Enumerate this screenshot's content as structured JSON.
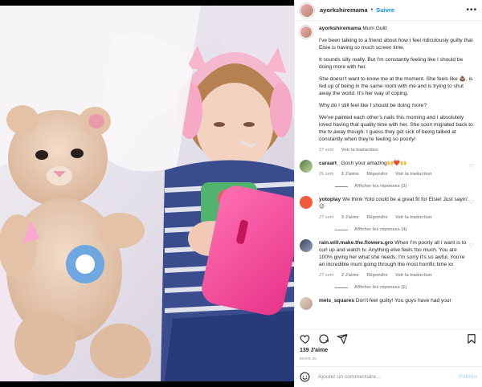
{
  "post": {
    "username": "ayorkshiremama",
    "follow_label": "Suivre",
    "more_label": "•••",
    "caption_title": "Mum Guilt",
    "caption_paragraphs": [
      "I've been talking to a friend about how I feel ridiculously guilty that Elsie is having so much screen time.",
      "It sounds silly really. But I'm constantly feeling like I should be doing more with her.",
      "She doesn't want to know me at the moment. She feels like 💩, is fed up of being in the same room with me and is trying to shut away the world. It's her way of coping.",
      "Why do I still feel like I should be doing more?",
      "We've painted each other's nails this morning and I absolutely loved having that quality time with her. She soon migrated back to the tv away though. I guess they get sick of being talked at constantly when they're feeling so poorly!"
    ],
    "caption_time": "27 sem",
    "translate_label": "Voir la traduction",
    "likes": "139 J'aime",
    "date": "MARS 30",
    "comment_placeholder": "Ajouter un commentaire...",
    "publish_label": "Publier"
  },
  "comments": [
    {
      "username": "caraart_",
      "text": "Gosh your amazing🙌❤️🙌",
      "time": "25 sem",
      "likes": "1 J'aime",
      "reply": "Répondre",
      "translate": "Voir la traduction",
      "replies": "Afficher les réponses (3)"
    },
    {
      "username": "yotoplay",
      "text": "We think Yoto could be a great fit for Elsie! Just sayin'. 😉",
      "time": "27 sem",
      "likes": "3 J'aime",
      "reply": "Répondre",
      "translate": "Voir la traduction",
      "replies": "Afficher les réponses (4)"
    },
    {
      "username": "rain.will.make.the.flowers.gro",
      "text": "When I'm poorly all I want is to curl up and watch tv. Anything else feels too much. You are 100% giving her what she needs. I'm sorry it's so awful. You're an incredible mum going through the most horrific time xx",
      "time": "27 sem",
      "likes": "2 J'aime",
      "reply": "Répondre",
      "translate": "Voir la traduction",
      "replies": "Afficher les réponses (1)"
    },
    {
      "username": "mels_squares",
      "text": "Don't feel guilty! You guys have had your"
    }
  ],
  "icons": {
    "heart": "heart-icon",
    "comment": "comment-icon",
    "share": "share-icon",
    "save": "bookmark-icon",
    "emoji": "emoji-icon"
  },
  "colors": {
    "link": "#0095f6",
    "muted": "#8e8e8e",
    "text": "#262626",
    "publish_disabled": "#b2dffc"
  }
}
